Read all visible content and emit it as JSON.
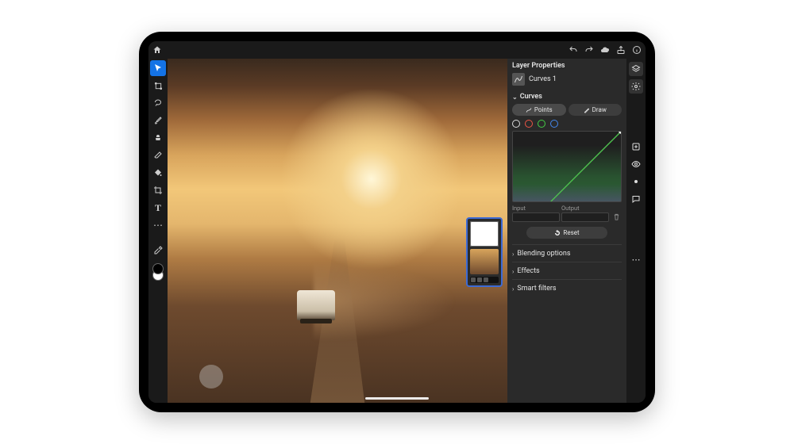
{
  "topbar": {
    "home": "home",
    "undo": "undo",
    "redo": "redo",
    "cloud": "cloud",
    "share": "share",
    "info": "info"
  },
  "tools": {
    "cursor": "cursor",
    "lasso": "lasso",
    "brush": "brush",
    "stamp": "stamp",
    "eraser": "eraser",
    "fill": "fill",
    "crop": "crop",
    "type_label": "T",
    "more": "more",
    "eyedropper": "eyedropper"
  },
  "layer_properties": {
    "title": "Layer Properties",
    "layer_name": "Curves 1"
  },
  "curves": {
    "section_label": "Curves",
    "points_btn": "Points",
    "draw_btn": "Draw",
    "channels": {
      "rgb": "RGB",
      "red": "Red",
      "green": "Green",
      "blue": "Blue"
    },
    "input_label": "Input",
    "output_label": "Output",
    "reset_label": "Reset"
  },
  "panes": {
    "blending": "Blending options",
    "effects": "Effects",
    "smart_filters": "Smart filters"
  },
  "right_rail": {
    "layers": "layers",
    "properties": "properties",
    "comments": "comments",
    "add": "add",
    "eye": "visibility",
    "styles": "styles",
    "actions": "actions"
  }
}
